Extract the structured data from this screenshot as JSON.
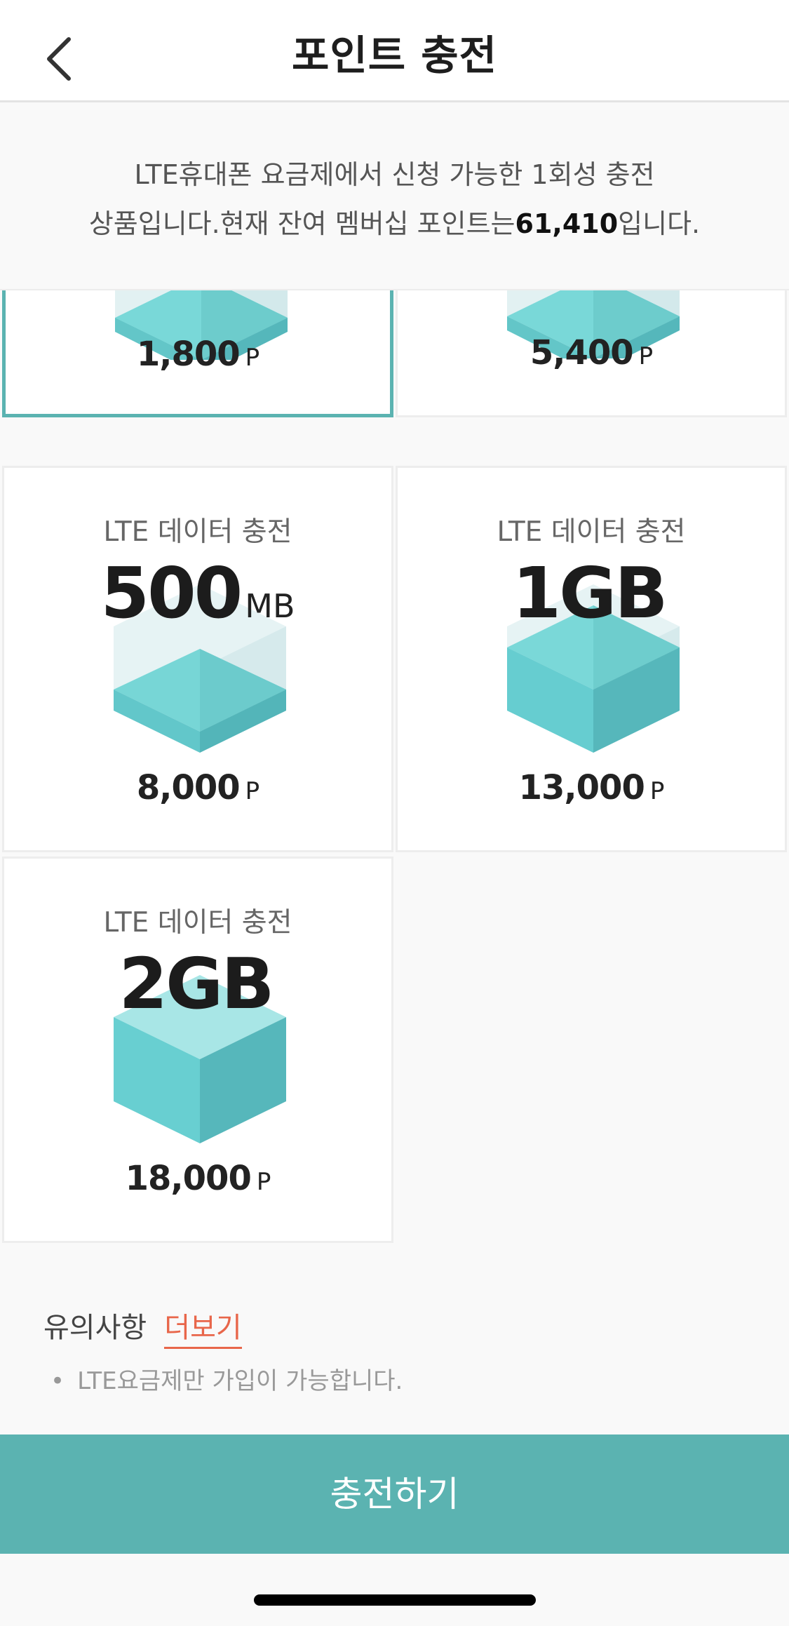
{
  "header": {
    "title": "포인트 충전"
  },
  "intro": {
    "line1": "LTE휴대폰 요금제에서 신청 가능한 1회성 충전",
    "line2_prefix": "상품입니다.현재 잔여 멤버십 포인트는",
    "points": "61,410",
    "line2_suffix": "입니다."
  },
  "products": [
    {
      "label": "",
      "size": "",
      "unit": "",
      "price": "1,800",
      "price_unit": "P",
      "selected": true
    },
    {
      "label": "",
      "size": "",
      "unit": "",
      "price": "5,400",
      "price_unit": "P",
      "selected": false
    },
    {
      "label": "LTE 데이터 충전",
      "size": "500",
      "unit": "MB",
      "price": "8,000",
      "price_unit": "P",
      "fill_level": 0.45
    },
    {
      "label": "LTE 데이터 충전",
      "size": "1GB",
      "unit": "",
      "price": "13,000",
      "price_unit": "P",
      "fill_level": 0.7
    },
    {
      "label": "LTE 데이터 충전",
      "size": "2GB",
      "unit": "",
      "price": "18,000",
      "price_unit": "P",
      "fill_level": 1.0
    }
  ],
  "notes": {
    "title": "유의사항",
    "more_link": "더보기",
    "items": [
      "LTE요금제만 가입이 가능합니다."
    ]
  },
  "cta": {
    "label": "충전하기"
  },
  "icons": {
    "back": "chevron-left-icon",
    "cube": "data-cube-icon"
  },
  "colors": {
    "accent": "#5bb3b1",
    "link": "#e8664a"
  }
}
